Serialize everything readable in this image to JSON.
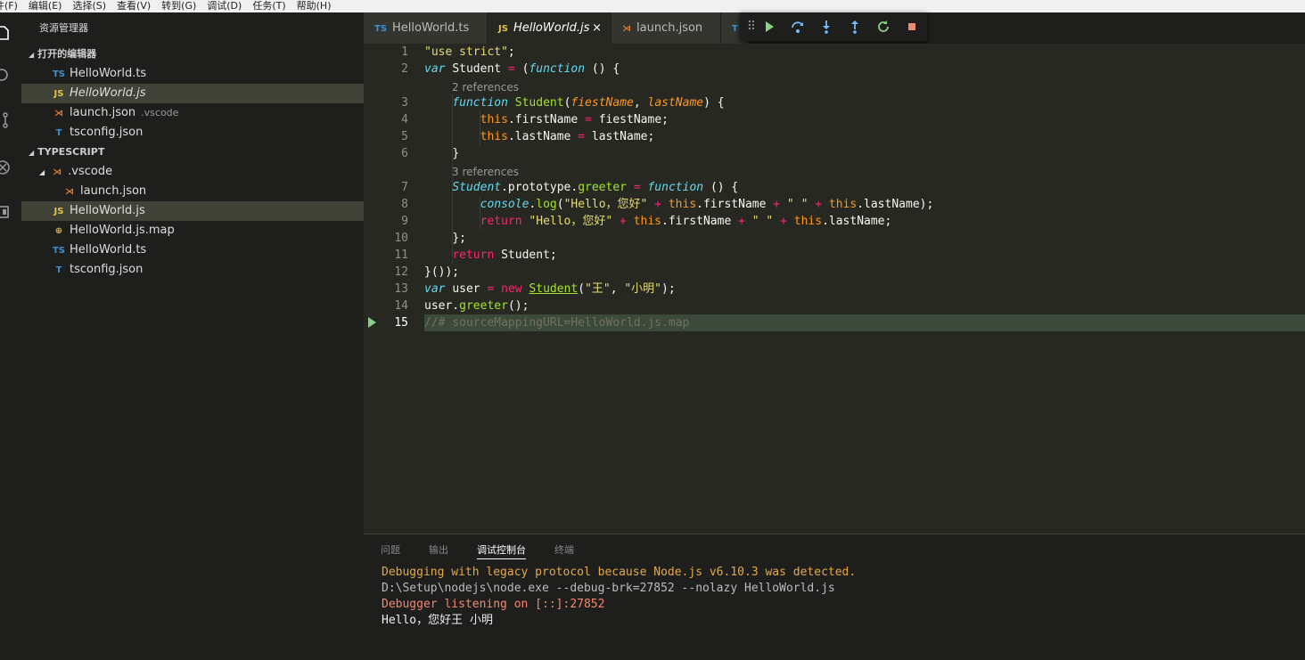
{
  "menubar": [
    "件(F)",
    "编辑(E)",
    "选择(S)",
    "查看(V)",
    "转到(G)",
    "调试(D)",
    "任务(T)",
    "帮助(H)"
  ],
  "sidebar": {
    "title": "资源管理器",
    "open_editors": {
      "label": "打开的编辑器",
      "items": [
        {
          "icon": "TS",
          "name": "HelloWorld.ts",
          "sub": ""
        },
        {
          "icon": "JS",
          "name": "HelloWorld.js",
          "sub": ""
        },
        {
          "icon": "vscode",
          "name": "launch.json",
          "sub": ".vscode"
        },
        {
          "icon": "TSC",
          "name": "tsconfig.json",
          "sub": ""
        }
      ]
    },
    "project": {
      "label": "TYPESCRIPT",
      "folder": ".vscode",
      "items": [
        {
          "icon": "vscode",
          "name": "launch.json"
        },
        {
          "icon": "JS",
          "name": "HelloWorld.js"
        },
        {
          "icon": "map",
          "name": "HelloWorld.js.map"
        },
        {
          "icon": "TS",
          "name": "HelloWorld.ts"
        },
        {
          "icon": "TSC",
          "name": "tsconfig.json"
        }
      ]
    }
  },
  "tabs": [
    {
      "icon": "TS",
      "label": "HelloWorld.ts"
    },
    {
      "icon": "JS",
      "label": "HelloWorld.js",
      "close": "×"
    },
    {
      "icon": "vscode",
      "label": "launch.json"
    },
    {
      "icon": "T",
      "label": ""
    }
  ],
  "icons": {
    "ts": "TS",
    "js": "JS",
    "tsc": "T",
    "vscode": "⋊",
    "map": "⊕"
  },
  "editor": {
    "line_numbers": [
      "1",
      "2",
      "3",
      "4",
      "5",
      "6",
      "7",
      "8",
      "9",
      "10",
      "11",
      "12",
      "13",
      "14",
      "15"
    ],
    "lens_1": "2 references",
    "lens_2": "3 references",
    "tokens": {
      "use_strict": "\"use strict\"",
      "semi": ";",
      "var": "var",
      "student": "Student",
      "eq": "=",
      "open_fn": "(",
      "function": "function",
      "parens_brace": "() {",
      "student_fn": "Student",
      "lp": "(",
      "p1": "fiestName",
      "comma": ", ",
      "p2": "lastName",
      "rp_brace": ") {",
      "this": "this",
      "dot_firstName": ".firstName",
      "fiestName_semi": "fiestName;",
      "dot_lastName": ".lastName",
      "lastName_semi": "lastName;",
      "close_brace": "}",
      "proto_prefix": ".prototype.",
      "greeter": "greeter",
      "console": "console",
      "dot": ".",
      "log": "log",
      "hello_str": "\"Hello，您好\"",
      "plus": "+",
      "space_str": "\" \"",
      "rparen_semi": ");",
      "return": "return",
      "semi_only": ";",
      "close_iife_brace": "};",
      "student_semi": "Student;",
      "iife_end": "}());",
      "user": "user",
      "new": "new",
      "wang": "\"王\"",
      "xiaoming": "\"小明\"",
      "user_dot": "user.",
      "greeter_call": "();",
      "source_map": "//# sourceMappingURL=HelloWorld.js.map"
    }
  },
  "panel": {
    "tabs": [
      "问题",
      "输出",
      "调试控制台",
      "终端"
    ],
    "active_tab": "调试控制台",
    "lines": [
      "Debugging with legacy protocol because Node.js v6.10.3 was detected.",
      "D:\\Setup\\nodejs\\node.exe --debug-brk=27852 --nolazy HelloWorld.js",
      "Debugger listening on [::]:27852",
      "Hello，您好王 小明"
    ]
  },
  "colors": {
    "editor_bg": "#272822",
    "sidebar_bg": "#1e1f1c",
    "string": "#e6db74",
    "keyword": "#66d9ef",
    "function": "#a6e22e",
    "param": "#fd971f",
    "operator": "#f92672",
    "debug_continue": "#89d185",
    "debug_stop": "#f48771"
  }
}
